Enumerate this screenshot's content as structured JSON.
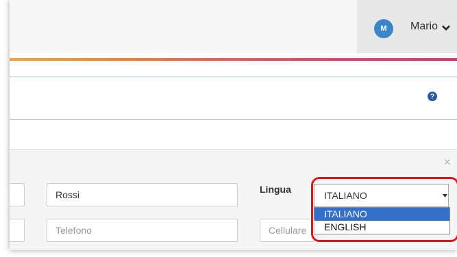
{
  "user": {
    "avatar_initial": "M",
    "name": "Mario"
  },
  "form": {
    "surname_value": "Rossi",
    "phone_placeholder": "Telefono",
    "mobile_placeholder": "Cellulare",
    "language_label": "Lingua",
    "language_selected": "ITALIANO",
    "language_options": [
      "ITALIANO",
      "ENGLISH"
    ]
  },
  "icons": {
    "help": "question-circle-icon",
    "close": "close-icon",
    "chevron": "chevron-down-icon"
  },
  "colors": {
    "avatar": "#3b86c8",
    "highlight": "#e0151b",
    "selected_option": "#3470c8"
  }
}
